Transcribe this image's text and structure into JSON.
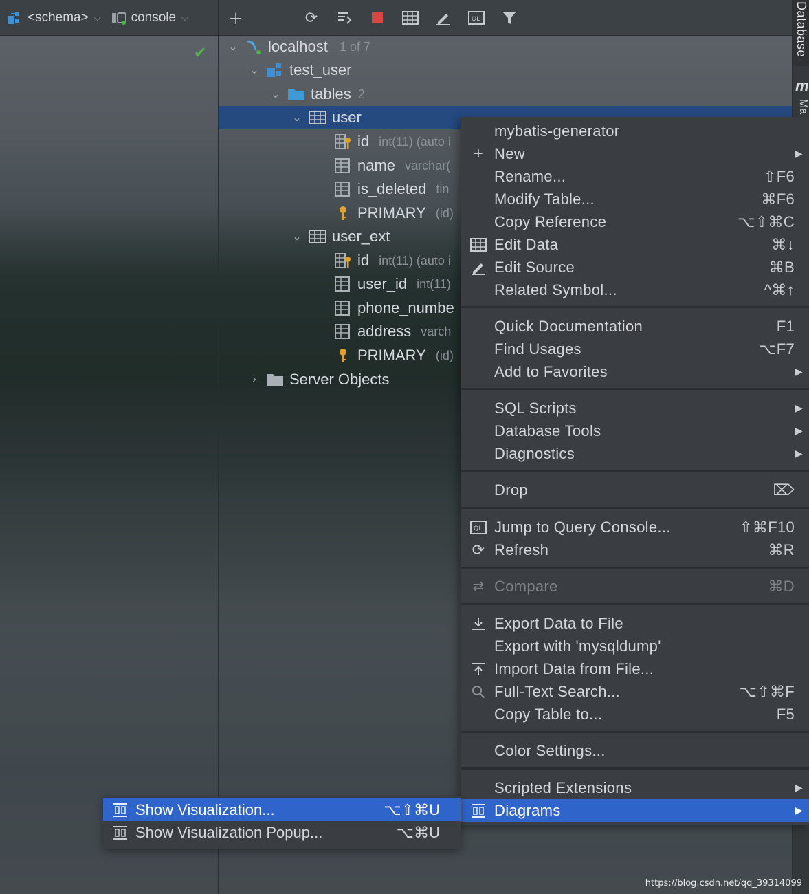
{
  "toolbar": {
    "schema_label": "<schema>",
    "console_label": "console"
  },
  "side_panel": {
    "database_tab": "Database",
    "m_label": "m",
    "m2_label": "Ma"
  },
  "tree": {
    "host": {
      "label": "localhost",
      "badge": "1 of 7"
    },
    "schema": {
      "label": "test_user"
    },
    "tables": {
      "label": "tables",
      "count": "2"
    },
    "user_table": {
      "label": "user",
      "columns": [
        {
          "name": "id",
          "hint": "int(11) (auto i"
        },
        {
          "name": "name",
          "hint": "varchar("
        },
        {
          "name": "is_deleted",
          "hint": "tin"
        }
      ],
      "key": {
        "name": "PRIMARY",
        "hint": "(id)"
      }
    },
    "user_ext_table": {
      "label": "user_ext",
      "columns": [
        {
          "name": "id",
          "hint": "int(11) (auto i"
        },
        {
          "name": "user_id",
          "hint": "int(11)"
        },
        {
          "name": "phone_numbe",
          "hint": ""
        },
        {
          "name": "address",
          "hint": "varch"
        }
      ],
      "key": {
        "name": "PRIMARY",
        "hint": "(id)"
      }
    },
    "server_objects": {
      "label": "Server Objects"
    }
  },
  "menu": {
    "items": [
      {
        "label": "mybatis-generator",
        "shortcut": ""
      },
      {
        "label": "New",
        "shortcut": ""
      },
      {
        "label": "Rename...",
        "shortcut": "⇧F6"
      },
      {
        "label": "Modify Table...",
        "shortcut": "⌘F6"
      },
      {
        "label": "Copy Reference",
        "shortcut": "⌥⇧⌘C"
      },
      {
        "label": "Edit Data",
        "shortcut": "⌘↓"
      },
      {
        "label": "Edit Source",
        "shortcut": "⌘B"
      },
      {
        "label": "Related Symbol...",
        "shortcut": "^⌘↑"
      },
      {
        "label": "Quick Documentation",
        "shortcut": "F1"
      },
      {
        "label": "Find Usages",
        "shortcut": "⌥F7"
      },
      {
        "label": "Add to Favorites",
        "shortcut": ""
      },
      {
        "label": "SQL Scripts",
        "shortcut": ""
      },
      {
        "label": "Database Tools",
        "shortcut": ""
      },
      {
        "label": "Diagnostics",
        "shortcut": ""
      },
      {
        "label": "Drop",
        "shortcut": "⌦"
      },
      {
        "label": "Jump to Query Console...",
        "shortcut": "⇧⌘F10"
      },
      {
        "label": "Refresh",
        "shortcut": "⌘R"
      },
      {
        "label": "Compare",
        "shortcut": "⌘D"
      },
      {
        "label": "Export Data to File",
        "shortcut": ""
      },
      {
        "label": "Export with 'mysqldump'",
        "shortcut": ""
      },
      {
        "label": "Import Data from File...",
        "shortcut": ""
      },
      {
        "label": "Full-Text Search...",
        "shortcut": "⌥⇧⌘F"
      },
      {
        "label": "Copy Table to...",
        "shortcut": "F5"
      },
      {
        "label": "Color Settings...",
        "shortcut": ""
      },
      {
        "label": "Scripted Extensions",
        "shortcut": ""
      },
      {
        "label": "Diagrams",
        "shortcut": ""
      }
    ]
  },
  "submenu": {
    "items": [
      {
        "label": "Show Visualization...",
        "shortcut": "⌥⇧⌘U"
      },
      {
        "label": "Show Visualization Popup...",
        "shortcut": "⌥⌘U"
      }
    ]
  },
  "watermark": "https://blog.csdn.net/qq_39314099",
  "colors": {
    "highlight": "#2f65ca",
    "selection": "#254a7f",
    "menu_bg": "#3a3e42",
    "ok_check": "#4fb548"
  }
}
